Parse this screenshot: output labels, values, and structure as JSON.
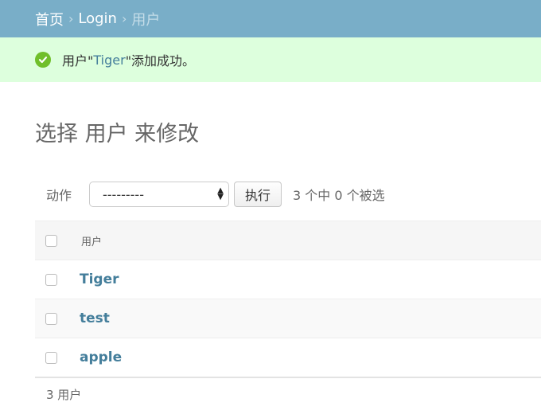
{
  "breadcrumbs": {
    "home": "首页",
    "separator": "›",
    "app": "Login",
    "current": "用户"
  },
  "message": {
    "prefix": "用户\"",
    "object": "Tiger",
    "suffix": "\"添加成功。",
    "icon": "check-circle-icon"
  },
  "page_title": "选择 用户 来修改",
  "actions": {
    "label": "动作",
    "select_value": "---------",
    "go_button": "执行",
    "counter": "3 个中 0 个被选"
  },
  "table": {
    "column_header": "用户",
    "rows": [
      {
        "name": "Tiger"
      },
      {
        "name": "test"
      },
      {
        "name": "apple"
      }
    ]
  },
  "paginator": "3 用户",
  "colors": {
    "header_bg": "#79aec8",
    "message_bg": "#ddffdd",
    "link": "#447e9b",
    "success": "#70bf2b"
  }
}
